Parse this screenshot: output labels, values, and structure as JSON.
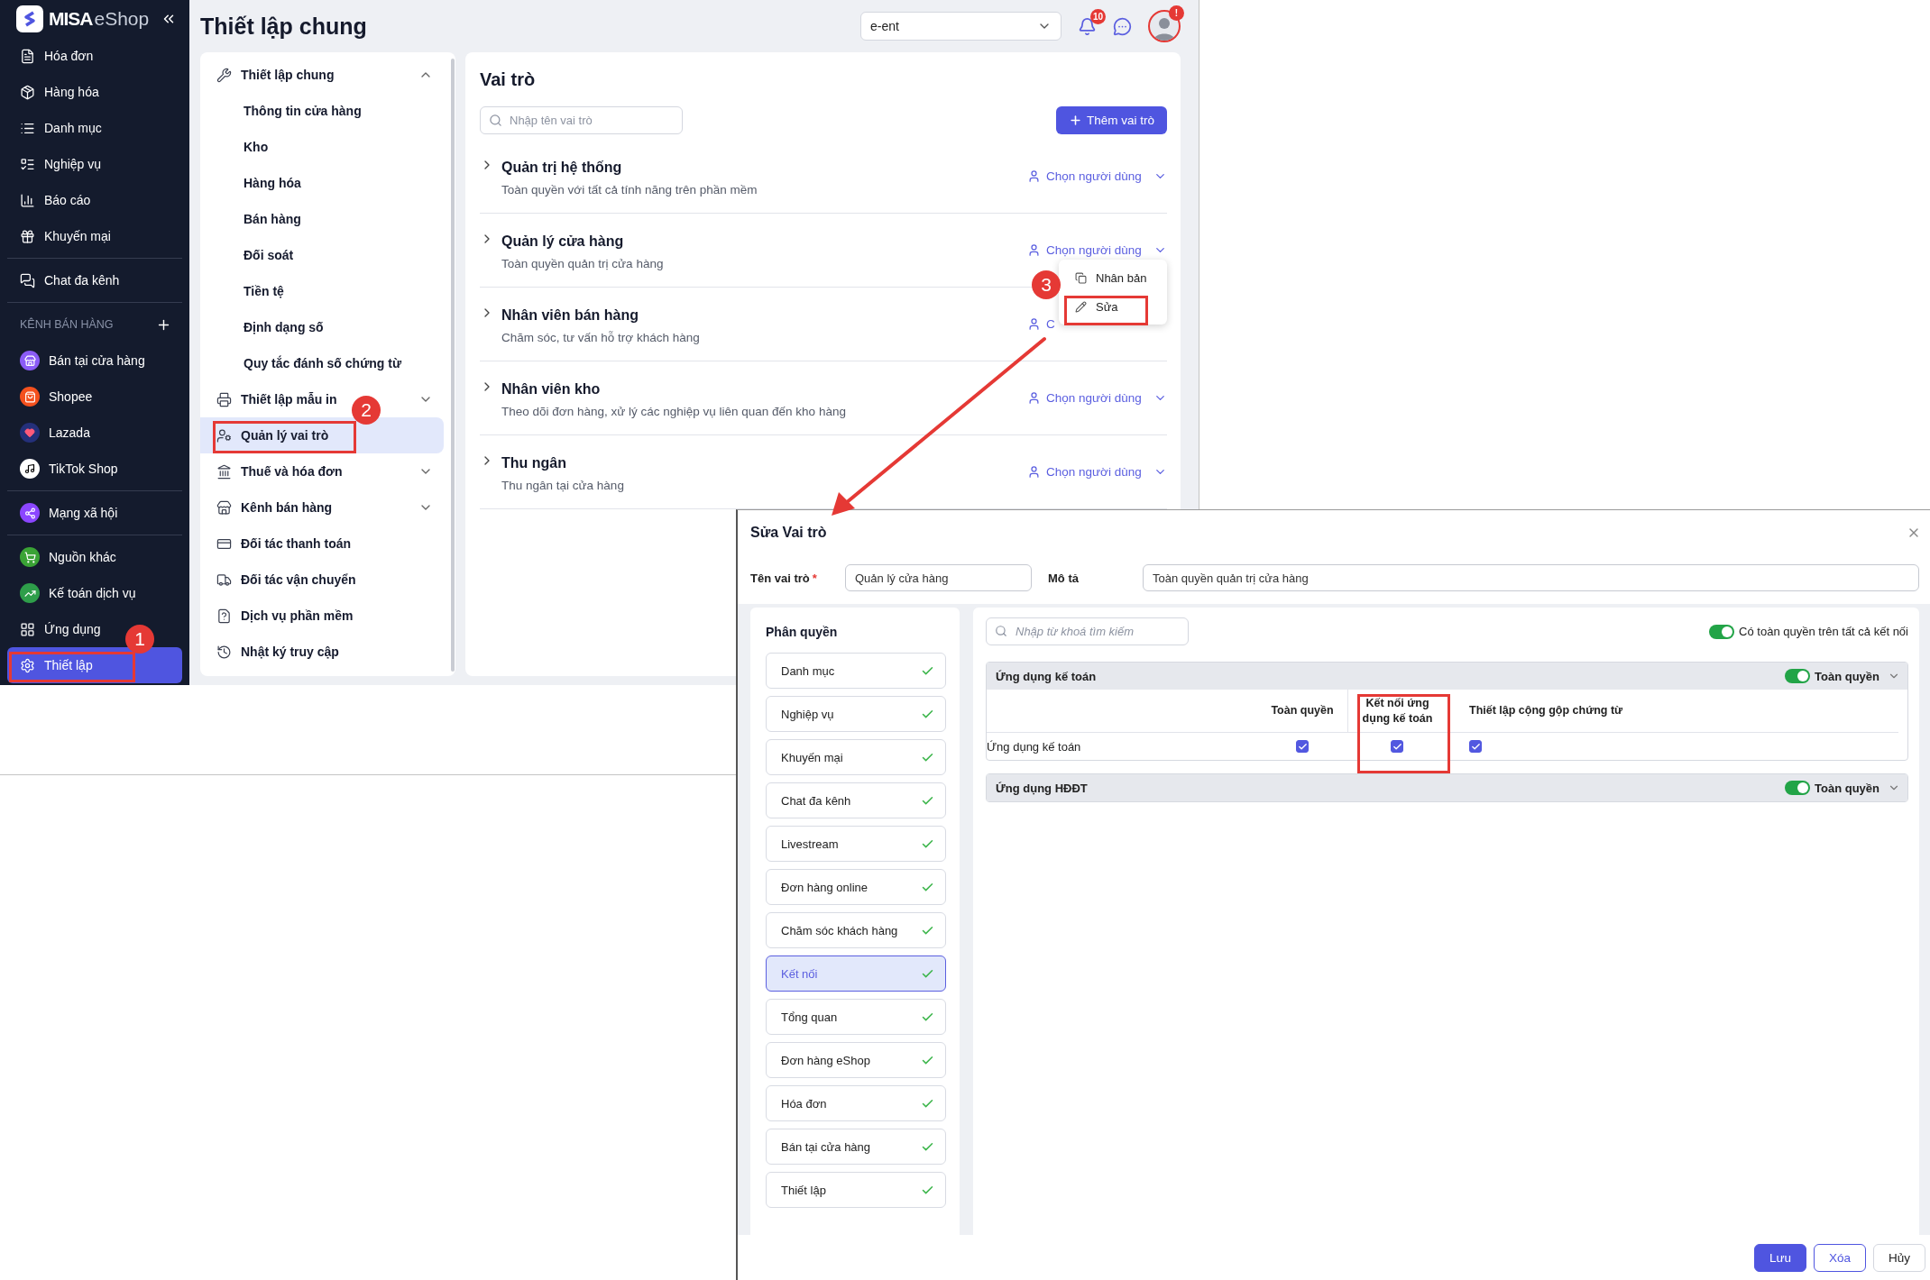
{
  "sidebar": {
    "brand": "MISA",
    "brand_suffix": "eShop",
    "groups": [
      {
        "items": [
          {
            "label": "Hóa đơn",
            "selected": false
          },
          {
            "label": "Hàng hóa",
            "selected": false
          },
          {
            "label": "Danh mục",
            "selected": false
          },
          {
            "label": "Nghiệp vụ",
            "selected": false
          },
          {
            "label": "Báo cáo",
            "selected": false
          },
          {
            "label": "Khuyến mại",
            "selected": false
          }
        ]
      },
      {
        "items": [
          {
            "label": "Chat đa kênh",
            "selected": false
          }
        ]
      },
      {
        "title": "KÊNH BÁN HÀNG",
        "items": [
          {
            "label": "Bán tại cửa hàng",
            "selected": false
          },
          {
            "label": "Shopee",
            "selected": false
          },
          {
            "label": "Lazada",
            "selected": false
          },
          {
            "label": "TikTok Shop",
            "selected": false
          }
        ]
      },
      {
        "items": [
          {
            "label": "Mạng xã hội",
            "selected": false
          }
        ]
      },
      {
        "items": [
          {
            "label": "Nguồn khác",
            "selected": false
          },
          {
            "label": "Kế toán dịch vụ",
            "selected": false
          },
          {
            "label": "Ứng dụng",
            "selected": false
          },
          {
            "label": "Thiết lập",
            "selected": true
          }
        ]
      }
    ]
  },
  "header": {
    "title": "Thiết lập chung",
    "store_select": "e-ent",
    "notification_count": "10",
    "avatar_badge": "!"
  },
  "settings_menu": {
    "items": [
      {
        "label": "Thiết lập chung",
        "kind": "group",
        "expanded": true,
        "selected": false,
        "children": [
          {
            "label": "Thông tin cửa hàng",
            "selected": false
          },
          {
            "label": "Kho",
            "selected": false
          },
          {
            "label": "Hàng hóa",
            "selected": false
          },
          {
            "label": "Bán hàng",
            "selected": false
          },
          {
            "label": "Đối soát",
            "selected": false
          },
          {
            "label": "Tiền tệ",
            "selected": false
          },
          {
            "label": "Định dạng số",
            "selected": false
          },
          {
            "label": "Quy tắc đánh số chứng từ",
            "selected": false
          }
        ]
      },
      {
        "label": "Thiết lập mẫu in",
        "kind": "group",
        "expanded": false,
        "selected": false
      },
      {
        "label": "Quản lý vai trò",
        "kind": "link",
        "selected": true
      },
      {
        "label": "Thuế và hóa đơn",
        "kind": "group",
        "expanded": false,
        "selected": false
      },
      {
        "label": "Kênh bán hàng",
        "kind": "group",
        "expanded": false,
        "selected": false
      },
      {
        "label": "Đối tác thanh toán",
        "kind": "link",
        "selected": false
      },
      {
        "label": "Đối tác vận chuyển",
        "kind": "link",
        "selected": false
      },
      {
        "label": "Dịch vụ phần mềm",
        "kind": "link",
        "selected": false
      },
      {
        "label": "Nhật ký truy cập",
        "kind": "link",
        "selected": false
      }
    ]
  },
  "roles": {
    "title": "Vai trò",
    "search": {
      "placeholder": "Nhập tên vai trò"
    },
    "add_button": "Thêm vai trò",
    "items": [
      {
        "name": "Quản trị hệ thống",
        "description": "Toàn quyền với tất cả tính năng trên phần mềm",
        "user_picker": "Chọn người dùng",
        "menu_open": false
      },
      {
        "name": "Quản lý cửa hàng",
        "description": "Toàn quyền quản trị cửa hàng",
        "user_picker": "Chọn người dùng",
        "menu_open": true
      },
      {
        "name": "Nhân viên bán hàng",
        "description": "Chăm sóc, tư vấn hỗ trợ khách hàng",
        "user_picker": "C",
        "menu_open": false
      },
      {
        "name": "Nhân viên kho",
        "description": "Theo dõi đơn hàng, xử lý các nghiệp vụ liên quan đến kho hàng",
        "user_picker": "Chọn người dùng",
        "menu_open": false
      },
      {
        "name": "Thu ngân",
        "description": "Thu ngân tại cửa hàng",
        "user_picker": "Chọn người dùng",
        "menu_open": false
      }
    ],
    "context_menu": [
      "Nhân bản",
      "Sửa"
    ]
  },
  "step_badges": [
    "1",
    "2",
    "3"
  ],
  "dialog": {
    "title": "Sửa Vai trò",
    "name_label": "Tên vai trò",
    "required_mark": "*",
    "name_value": "Quản lý cửa hàng",
    "description_label": "Mô tả",
    "description_value": "Toàn quyền quản trị cửa hàng",
    "permissions": {
      "title": "Phân quyền",
      "items": [
        {
          "label": "Danh mục",
          "checked": true,
          "selected": false
        },
        {
          "label": "Nghiệp vụ",
          "checked": true,
          "selected": false
        },
        {
          "label": "Khuyến mại",
          "checked": true,
          "selected": false
        },
        {
          "label": "Chat đa kênh",
          "checked": true,
          "selected": false
        },
        {
          "label": "Livestream",
          "checked": true,
          "selected": false
        },
        {
          "label": "Đơn hàng online",
          "checked": true,
          "selected": false
        },
        {
          "label": "Chăm sóc khách hàng",
          "checked": true,
          "selected": false
        },
        {
          "label": "Kết nối",
          "checked": true,
          "selected": true
        },
        {
          "label": "Tổng quan",
          "checked": true,
          "selected": false
        },
        {
          "label": "Đơn hàng eShop",
          "checked": true,
          "selected": false
        },
        {
          "label": "Hóa đơn",
          "checked": true,
          "selected": false
        },
        {
          "label": "Bán tại cửa hàng",
          "checked": true,
          "selected": false
        },
        {
          "label": "Thiết lập",
          "checked": true,
          "selected": false
        }
      ]
    },
    "search": {
      "placeholder": "Nhập từ khoá tìm kiếm"
    },
    "full_access_all": {
      "label": "Có toàn quyền trên tất cả kết nối",
      "on": true
    },
    "sections": [
      {
        "title": "Ứng dụng kế toán",
        "toggle_label": "Toàn quyền",
        "on": true,
        "columns": [
          "Toàn quyền",
          "Kết nối ứng dụng kế toán",
          "Thiết lập cộng gộp chứng từ"
        ],
        "rows": [
          {
            "name": "Ứng dụng kế toán",
            "cells": [
              {
                "checked": true
              },
              {
                "checked": true
              },
              {
                "checked": true
              }
            ]
          }
        ]
      },
      {
        "title": "Ứng dụng HĐĐT",
        "toggle_label": "Toàn quyền",
        "on": true
      }
    ],
    "buttons": [
      {
        "label": "Lưu",
        "kind": "primary"
      },
      {
        "label": "Xóa",
        "kind": "outline"
      },
      {
        "label": "Hủy",
        "kind": "plain"
      }
    ]
  }
}
